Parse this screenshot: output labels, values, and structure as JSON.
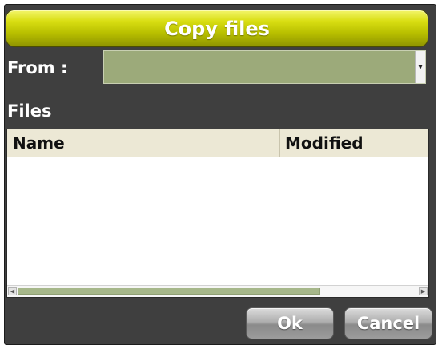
{
  "dialog": {
    "title": "Copy files",
    "from_label": "From :",
    "from_value": "",
    "files_label": "Files",
    "columns": [
      "Name",
      "Modified"
    ],
    "rows": [],
    "ok_label": "Ok",
    "cancel_label": "Cancel",
    "colors": {
      "title_bar": "#c2c800",
      "combo_fill": "#9caa7a",
      "dialog_bg": "#3f3f3f"
    }
  }
}
